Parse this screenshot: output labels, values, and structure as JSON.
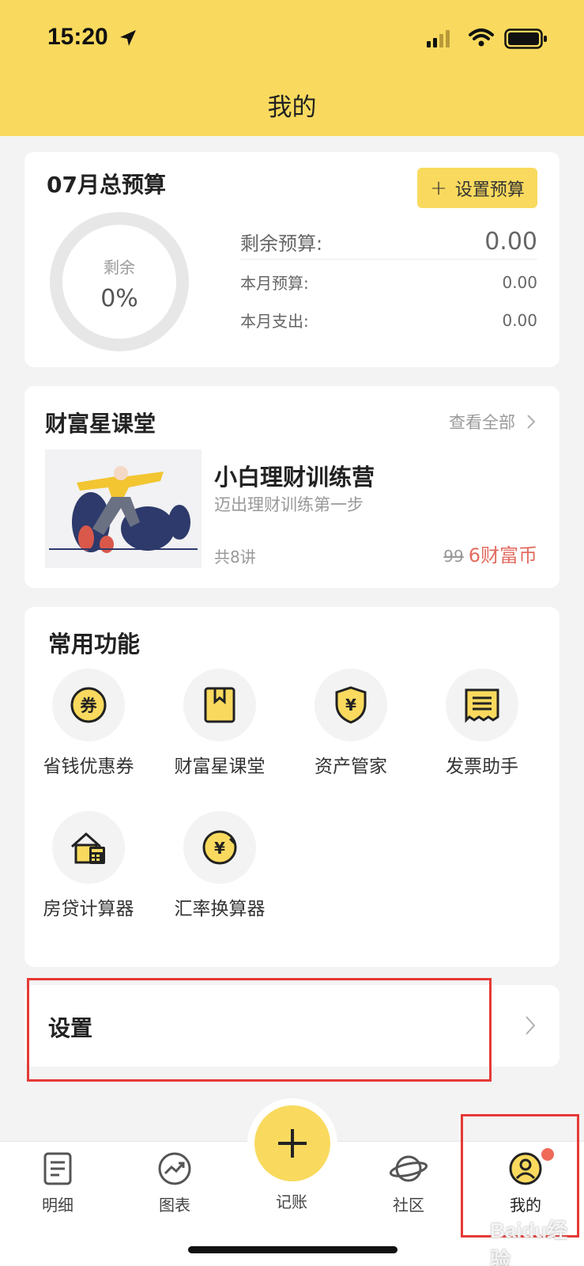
{
  "status_bar": {
    "time": "15:20"
  },
  "header": {
    "title": "我的"
  },
  "budget": {
    "title": "07月总预算",
    "set_button": "设置预算",
    "ring_label": "剩余",
    "ring_value": "0%",
    "ring_fraction": 0,
    "rows": [
      {
        "label": "剩余预算:",
        "value": "0.00"
      },
      {
        "label": "本月预算:",
        "value": "0.00"
      },
      {
        "label": "本月支出:",
        "value": "0.00"
      }
    ]
  },
  "course": {
    "section_title": "财富星课堂",
    "view_all": "查看全部",
    "name": "小白理财训练营",
    "subtitle": "迈出理财训练第一步",
    "lessons": "共8讲",
    "old_price": "99",
    "price": "6财富币"
  },
  "functions": {
    "title": "常用功能",
    "items": [
      {
        "label": "省钱优惠券",
        "icon": "coupon-icon"
      },
      {
        "label": "财富星课堂",
        "icon": "book-icon"
      },
      {
        "label": "资产管家",
        "icon": "shield-yen-icon"
      },
      {
        "label": "发票助手",
        "icon": "invoice-icon"
      },
      {
        "label": "房贷计算器",
        "icon": "house-calculator-icon"
      },
      {
        "label": "汇率换算器",
        "icon": "exchange-icon"
      }
    ]
  },
  "settings": {
    "label": "设置"
  },
  "tabbar": {
    "tabs": [
      {
        "label": "明细",
        "icon": "list-icon"
      },
      {
        "label": "图表",
        "icon": "chart-icon"
      },
      {
        "label": "记账",
        "icon": "plus-icon"
      },
      {
        "label": "社区",
        "icon": "planet-icon"
      },
      {
        "label": "我的",
        "icon": "profile-icon"
      }
    ]
  },
  "watermark": "Baidu经验",
  "colors": {
    "accent": "#f9da5e",
    "highlight": "#e53935",
    "price": "#e36b5f"
  }
}
